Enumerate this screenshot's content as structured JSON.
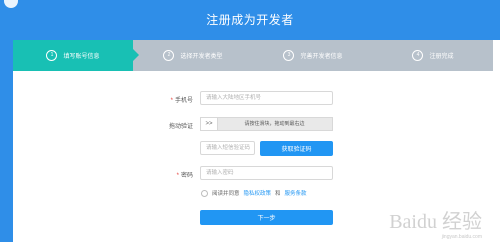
{
  "header": {
    "title": "注册成为开发者",
    "color": "#2f8ee8"
  },
  "steps": [
    {
      "num": "1",
      "label": "填写账号信息",
      "active": true
    },
    {
      "num": "2",
      "label": "选择开发者类型",
      "active": false
    },
    {
      "num": "3",
      "label": "完善开发者信息",
      "active": false
    },
    {
      "num": "4",
      "label": "注册完成",
      "active": false
    }
  ],
  "form": {
    "phone_label": "手机号",
    "phone_placeholder": "请输入大陆地区手机号",
    "slider_label": "拖动验证",
    "slider_handle": ">>",
    "slider_text": "请按住滑块，拖动到最右边",
    "code_placeholder": "请输入短信验证码",
    "get_code_button": "获取验证码",
    "password_label": "密码",
    "password_placeholder": "请输入密码",
    "agree_text": "阅读并同意",
    "privacy_link": "隐私权政策",
    "and_text": "和",
    "service_link": "服务条款",
    "next_button": "下一步"
  },
  "watermark": {
    "logo": "Baidu 经验",
    "sub": "jingyan.baidu.com"
  },
  "colors": {
    "active_step": "#18c0b4",
    "inactive_step": "#b7c1cb",
    "primary_button": "#2196f3",
    "required": "#e53935"
  }
}
